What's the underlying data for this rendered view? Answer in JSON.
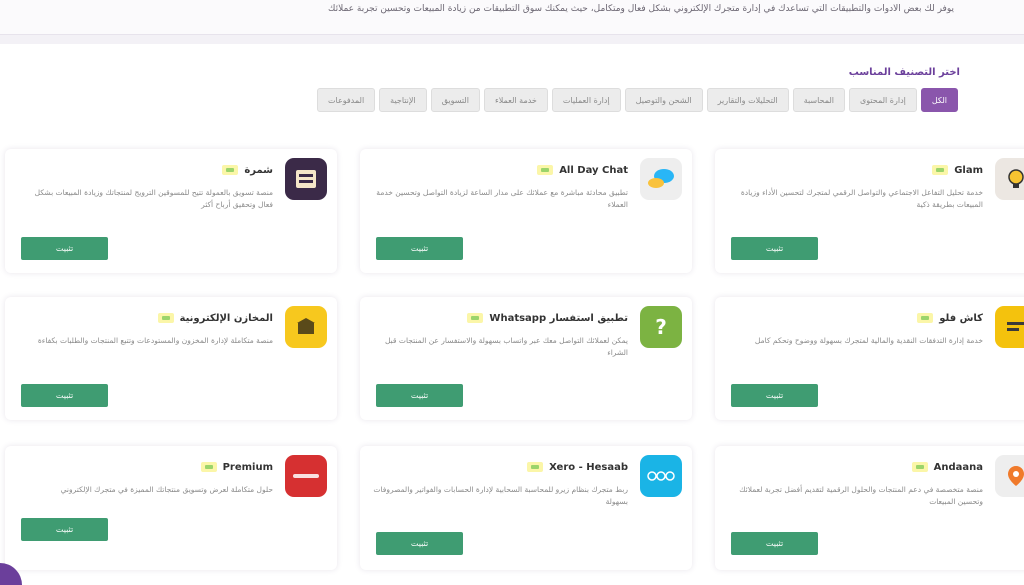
{
  "header": {
    "intro_text": "يوفر لك بعض الأدوات والتطبيقات التي تساعدك في إدارة متجرك الإلكتروني بشكل فعال ومتكامل، حيث يمكنك سوق التطبيقات من زيادة المبيعات وتحسين تجربة عملائك"
  },
  "categories": {
    "title": "اختر التصنيف المناسب",
    "tabs": [
      {
        "label": "الكل",
        "active": true
      },
      {
        "label": "إدارة المحتوى",
        "active": false
      },
      {
        "label": "المحاسبة",
        "active": false
      },
      {
        "label": "التحليلات والتقارير",
        "active": false
      },
      {
        "label": "الشحن والتوصيل",
        "active": false
      },
      {
        "label": "إدارة العمليات",
        "active": false
      },
      {
        "label": "خدمة العملاء",
        "active": false
      },
      {
        "label": "التسويق",
        "active": false
      },
      {
        "label": "الإنتاجية",
        "active": false
      },
      {
        "label": "المدفوعات",
        "active": false
      }
    ]
  },
  "apps": [
    {
      "name": "Glam",
      "desc": "خدمة تحليل التفاعل الاجتماعي والتواصل الرقمي لمتجرك لتحسين الأداء وزيادة المبيعات بطريقة ذكية",
      "button": "تثبيت",
      "logo_color": "#ece7e2",
      "logo_icon": "bulb-logo-icon"
    },
    {
      "name": "All Day Chat",
      "desc": "تطبيق محادثة مباشرة مع عملائك على مدار الساعة لزيادة التواصل وتحسين خدمة العملاء",
      "button": "تثبيت",
      "logo_color": "#eeeeee",
      "logo_icon": "chat-bubbles-logo-icon"
    },
    {
      "name": "شمرة",
      "desc": "منصة تسويق بالعمولة تتيح للمسوقين الترويج لمنتجاتك وزيادة المبيعات بشكل فعال وتحقيق أرباح أكثر",
      "button": "تثبيت",
      "logo_color": "#3b2a48",
      "logo_icon": "shamra-logo-icon"
    },
    {
      "name": "كاش فلو",
      "desc": "خدمة إدارة التدفقات النقدية والمالية لمتجرك بسهولة ووضوح وتحكم كامل",
      "button": "تثبيت",
      "logo_color": "#f4c20d",
      "logo_icon": "cashflow-logo-icon"
    },
    {
      "name": "تطبيق استفسار Whatsapp",
      "desc": "يمكن لعملائك التواصل معك عبر واتساب بسهولة والاستفسار عن المنتجات قبل الشراء",
      "button": "تثبيت",
      "logo_color": "#7cb342",
      "logo_icon": "question-logo-icon"
    },
    {
      "name": "المخازن الإلكترونية",
      "desc": "منصة متكاملة لإدارة المخزون والمستودعات وتتبع المنتجات والطلبات بكفاءة",
      "button": "تثبيت",
      "logo_color": "#f7c81e",
      "logo_icon": "store-logo-icon"
    },
    {
      "name": "Andaana",
      "desc": "منصة متخصصة في دعم المنتجات والحلول الرقمية لتقديم أفضل تجربة لعملائك وتحسين المبيعات",
      "button": "تثبيت",
      "logo_color": "#eeeeee",
      "logo_icon": "pin-logo-icon"
    },
    {
      "name": "Xero - Hesaab",
      "desc": "ربط متجرك بنظام زيرو للمحاسبة السحابية لإدارة الحسابات والفواتير والمصروفات بسهولة",
      "button": "تثبيت",
      "logo_color": "#1ab4e6",
      "logo_icon": "xero-logo-icon"
    },
    {
      "name": "Premium",
      "desc": "حلول متكاملة لعرض وتسويق منتجاتك المميزة في متجرك الإلكتروني",
      "button": "تثبيت",
      "logo_color": "#d63031",
      "logo_icon": "premium-logo-icon"
    }
  ]
}
